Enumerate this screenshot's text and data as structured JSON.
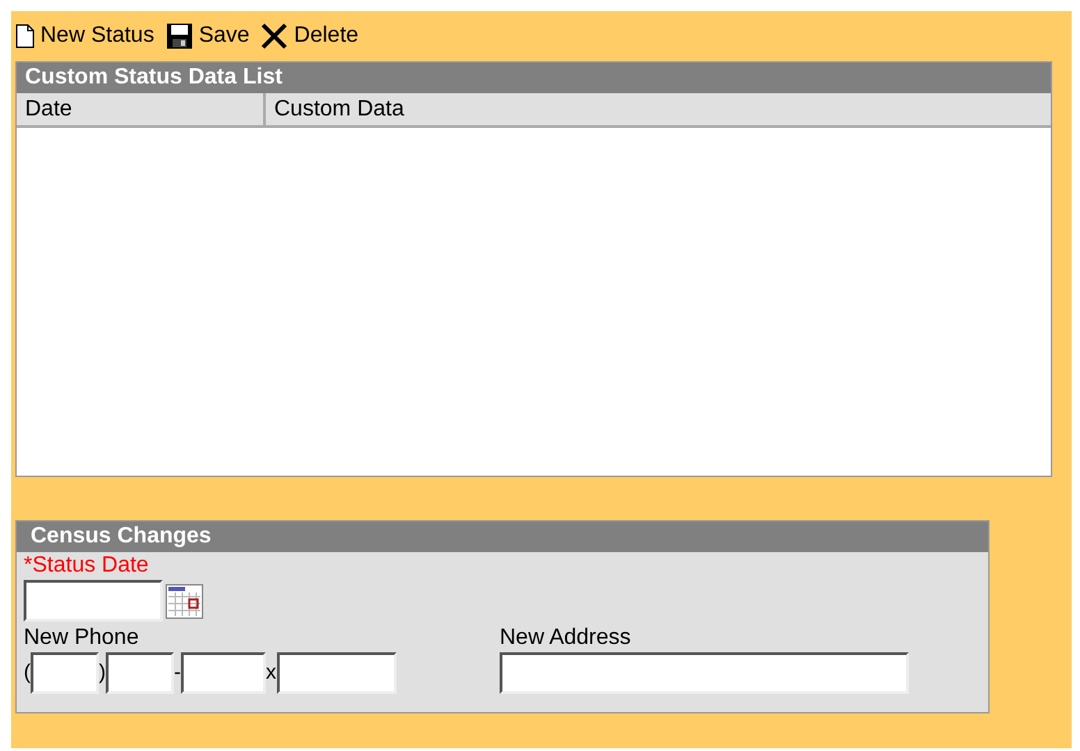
{
  "toolbar": [
    {
      "kind": "new",
      "label": "New Status"
    },
    {
      "kind": "save",
      "label": "Save"
    },
    {
      "kind": "delete",
      "label": "Delete"
    }
  ],
  "list": {
    "title": "Custom Status Data List",
    "columns": [
      "Date",
      "Custom Data"
    ]
  },
  "form": {
    "title": "Census Changes",
    "status_date": {
      "label": "*Status Date"
    },
    "phone": {
      "label": "New Phone",
      "open": "(",
      "close": ")",
      "dash": "-",
      "ext": "x"
    },
    "address": {
      "label": "New Address"
    }
  }
}
